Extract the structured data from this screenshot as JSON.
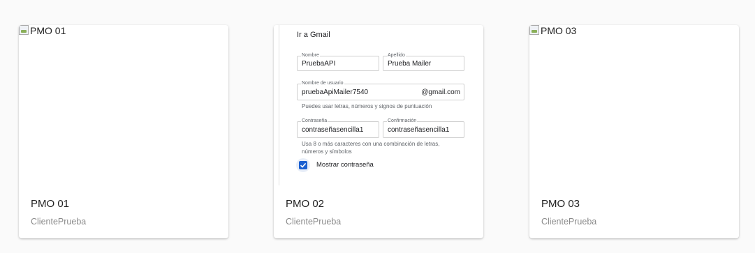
{
  "cards": [
    {
      "image_alt": "PMO 01",
      "title": "PMO 01",
      "subtitle": "ClientePrueba"
    },
    {
      "title": "PMO 02",
      "subtitle": "ClientePrueba",
      "preview": {
        "header": "Ir a Gmail",
        "first_name": {
          "label": "Nombre",
          "value": "PruebaAPI"
        },
        "last_name": {
          "label": "Apellido",
          "value": "Prueba Mailer"
        },
        "username": {
          "label": "Nombre de usuario",
          "value": "pruebaApiMailer7540",
          "suffix": "@gmail.com"
        },
        "username_hint": "Puedes usar letras, números y signos de puntuación",
        "password": {
          "label": "Contraseña",
          "value": "contraseñasencilla1"
        },
        "confirm": {
          "label": "Confirmación",
          "value": "contraseñasencilla1"
        },
        "password_hint_1": "Usa 8 o más caracteres con una combinación de letras,",
        "password_hint_2": "números y símbolos",
        "show_password_label": "Mostrar contraseña",
        "show_password_checked": true
      }
    },
    {
      "image_alt": "PMO 03",
      "title": "PMO 03",
      "subtitle": "ClientePrueba"
    }
  ]
}
